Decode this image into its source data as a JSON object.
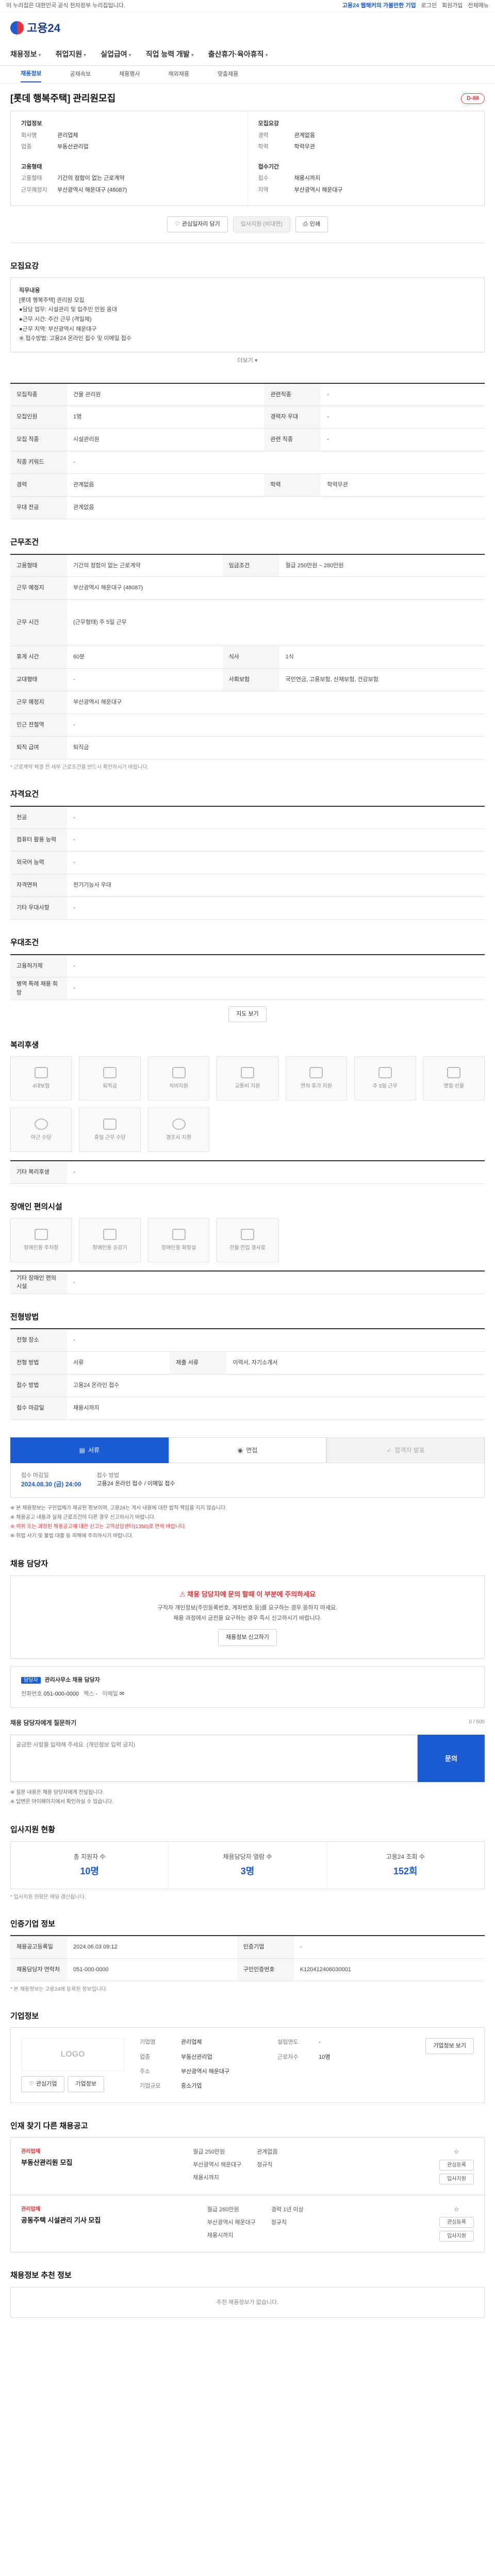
{
  "topbar": {
    "notice": "이 누리집은 대한민국 공식 전자정부 누리집입니다.",
    "right": [
      "고용24 웹해커의 가볼만한 기업",
      "로그인",
      "회원가입",
      "전체메뉴"
    ]
  },
  "brand": {
    "name": "고용24"
  },
  "gnb": [
    "채용정보",
    "취업지원",
    "실업급여",
    "직업 능력 개발",
    "출산휴가·육아휴직"
  ],
  "snb": [
    "채용정보",
    "공채속보",
    "채용행사",
    "해외채용",
    "맞춤채용"
  ],
  "job": {
    "title": "[롯데 행복주택] 관리원모집",
    "dday": "D-88",
    "company_label": "기업정보",
    "company_rows": [
      {
        "k": "회사명",
        "v": "관리업체"
      },
      {
        "k": "업종",
        "v": "부동산관리업"
      }
    ],
    "condition_label": "고용형태",
    "condition_rows": [
      {
        "k": "고용형태",
        "v": "기간의 정함이 없는 근로계약"
      },
      {
        "k": "근무예정지",
        "v": "부산광역시 해운대구 (48087)"
      }
    ],
    "recruit_label": "모집요강",
    "recruit_rows": [
      {
        "k": "경력",
        "v": "관계없음"
      },
      {
        "k": "학력",
        "v": "학력무관"
      }
    ],
    "period_label": "접수기간",
    "period_rows": [
      {
        "k": "접수",
        "v": "채용시까지"
      },
      {
        "k": "지역",
        "v": "부산광역시 해운대구"
      }
    ],
    "buttons": {
      "scrap": "관심일자리 담기",
      "apply": "입사지원 (비대면)",
      "print": "인쇄"
    }
  },
  "sections": {
    "recruit_detail": "모집요강",
    "recruit_detail_text": [
      "직무내용",
      "[롯데 행복주택] 관리원 모집",
      "●담당 업무: 시설관리 및 입주민 민원 응대",
      "●근무 시간: 주간 근무 (격일제)",
      "●근무 지역: 부산광역시 해운대구",
      "※ 접수방법: 고용24 온라인 접수 및 이메일 접수"
    ],
    "recruit_more": "더보기",
    "condition_title": "근무조건",
    "qualification_title": "자격요건",
    "preference_title": "우대조건",
    "welfare_title": "복리후생",
    "disability_title": "장애인 편의시설",
    "selection_title": "전형방법",
    "contact_title": "채용 담당자",
    "stats_title": "입사지원 현황",
    "info_title": "인증기업 정보",
    "company_title": "기업정보",
    "other_jobs_title": "인재 찾기 다른 채용공고",
    "recommend_title": "채용정보 추천 정보"
  },
  "recruit_table": [
    {
      "k": "모집직종",
      "v": "건물 관리원",
      "k2": "관련직종",
      "v2": "-"
    },
    {
      "k": "모집인원",
      "v": "1명",
      "k2": "경력자 우대",
      "v2": "-"
    },
    {
      "k": "모집 직종",
      "v": "시설관리원",
      "k2": "관련 직종",
      "v2": "-"
    },
    {
      "k": "직종 키워드",
      "v": "-",
      "k2": "",
      "v2": ""
    },
    {
      "k": "경력",
      "v": "관계없음",
      "k2": "학력",
      "v2": "학력무관"
    },
    {
      "k": "우대 전공",
      "v": "관계없음",
      "k2": "",
      "v2": ""
    }
  ],
  "condition_table": [
    {
      "k": "고용형태",
      "v": "기간의 정함이 없는 근로계약",
      "k2": "임금조건",
      "v2": "월급 250만원 ~ 280만원"
    },
    {
      "k": "근무 예정지",
      "v": "부산광역시 해운대구 (48087)",
      "k2": "",
      "v2": ""
    },
    {
      "k": "근무 시간",
      "v": "(근무형태) 주 5일 근무",
      "k2": "",
      "v2": ""
    },
    {
      "k": "휴게 시간",
      "v": "60분",
      "k2": "식사",
      "v2": "1식"
    },
    {
      "k": "교대형태",
      "v": "-",
      "k2": "사회보험",
      "v2": "국민연금, 고용보험, 산재보험, 건강보험"
    },
    {
      "k": "근무 예정지",
      "v": "부산광역시 해운대구",
      "k2": "",
      "v2": ""
    },
    {
      "k": "인근 전철역",
      "v": "-",
      "k2": "",
      "v2": ""
    },
    {
      "k": "퇴직 급여",
      "v": "퇴직금",
      "k2": "",
      "v2": ""
    }
  ],
  "condition_note": "* 근로계약 체결 전 세부 근로조건을 반드시 확인하시기 바랍니다.",
  "qualification_table": [
    {
      "k": "전공",
      "v": "-"
    },
    {
      "k": "컴퓨터 활용 능력",
      "v": "-"
    },
    {
      "k": "외국어 능력",
      "v": "-"
    },
    {
      "k": "자격면허",
      "v": "전기기능사 우대"
    },
    {
      "k": "기타 우대사항",
      "v": "-"
    }
  ],
  "preference_table": [
    {
      "k": "고용허가제",
      "v": "-"
    },
    {
      "k": "병역 특례 채용 희망",
      "v": "-"
    }
  ],
  "welfare": {
    "items": [
      "4대보험",
      "퇴직금",
      "식비지원",
      "교통비 지원",
      "연차 휴가 지원",
      "주 5일 근무",
      "명절 선물",
      "야근 수당",
      "휴일 근무 수당",
      "경조사 지원"
    ],
    "other_label": "기타 복리후생",
    "other_value": "-"
  },
  "disability": {
    "items": [
      "장애인용 주차장",
      "장애인용 승강기",
      "장애인용 화장실",
      "건물 진입 경사로"
    ],
    "other_label": "기타 장애인 편의시설",
    "other_value": "-"
  },
  "selection": {
    "table": [
      {
        "k": "전형 장소",
        "v": "-"
      },
      {
        "k": "전형 방법",
        "v": "서류",
        "k2": "제출 서류",
        "v2": "이력서, 자기소개서"
      },
      {
        "k": "접수 방법",
        "v": "고용24 온라인 접수",
        "k2": "",
        "v2": ""
      },
      {
        "k": "접수 마감일",
        "v": "채용시까지",
        "k2": "",
        "v2": ""
      }
    ],
    "tabs": [
      "서류",
      "면접",
      "합격자 발표"
    ],
    "date": "2024.08.30 (금) 24:00",
    "date_label": "접수 마감일",
    "method_label": "접수 방법",
    "method_value": "고용24 온라인 접수 / 이메일 접수",
    "notes": [
      "※ 본 채용정보는 구인업체가 제공한 정보이며, 고용24는 게시 내용에 대한 법적 책임을 지지 않습니다.",
      "※ 채용공고 내용과 실제 근로조건이 다른 경우 신고하시기 바랍니다.",
      "※ 허위 또는 과장된 채용공고에 대한 신고는 고객상담센터(1350)로 연락 바랍니다.",
      "※ 취업 사기 및 불법 대출 등 피해에 주의하시기 바랍니다."
    ]
  },
  "contact": {
    "warn_title": "채용 담당자에 문의 할때 이 부분에 주의하세요",
    "warn_lines": [
      "구직자 개인정보(주민등록번호, 계좌번호 등)를 요구하는 경우 응하지 마세요.",
      "채용 과정에서 금전을 요구하는 경우 즉시 신고하시기 바랍니다."
    ],
    "warn_button": "채용정보 신고하기",
    "badge": "담당자",
    "person": "관리사무소 채용 담당자",
    "phone_label": "전화번호",
    "phone": "051-000-0000",
    "fax_label": "팩스",
    "fax": "-",
    "email_label": "이메일",
    "ask_label": "채용 담당자에게 질문하기",
    "ask_placeholder": "궁금한 사항을 입력해 주세요. (개인정보 입력 금지)",
    "ask_button": "문의",
    "ask_count": "0 / 500",
    "notes": [
      "※ 질문 내용은 채용 담당자에게 전달됩니다.",
      "※ 답변은 마이페이지에서 확인하실 수 있습니다."
    ]
  },
  "stats": {
    "items": [
      {
        "label": "총 지원자 수",
        "value": "10명"
      },
      {
        "label": "채용담당자 열람 수",
        "value": "3명"
      },
      {
        "label": "고용24 조회 수",
        "value": "152회"
      }
    ],
    "note": "* 입사지원 현황은 매일 갱신됩니다."
  },
  "certified": {
    "table": [
      {
        "k": "채용공고등록일",
        "v": "2024.06.03 09:12",
        "k2": "인증기업",
        "v2": "-"
      },
      {
        "k": "채용담당자 연락처",
        "v": "051-000-0000",
        "k2": "구인인증번호",
        "v2": "K120412406030001"
      }
    ],
    "note": "* 본 채용정보는 고용24에 등록된 정보입니다."
  },
  "company": {
    "logo": "LOGO",
    "buttons": [
      "관심기업",
      "기업정보"
    ],
    "rows": [
      {
        "k": "기업명",
        "v": "관리업체",
        "k2": "설립연도",
        "v2": "-"
      },
      {
        "k": "업종",
        "v": "부동산관리업",
        "k2": "근로자수",
        "v2": "10명"
      },
      {
        "k": "주소",
        "v": "부산광역시 해운대구",
        "k2": "",
        "v2": ""
      },
      {
        "k": "기업규모",
        "v": "중소기업",
        "k2": "",
        "v2": ""
      }
    ],
    "detail_button": "기업정보 보기"
  },
  "other_jobs": [
    {
      "co": "관리업체",
      "title": "부동산관리원 모집",
      "pay": "월급 250만원",
      "career": "관계없음",
      "region": "부산광역시 해운대구",
      "type": "정규직",
      "date": "채용시까지",
      "btns": [
        "관심등록",
        "입사지원"
      ]
    },
    {
      "co": "관리업체",
      "title": "공동주택 시설관리 기사 모집",
      "pay": "월급 260만원",
      "career": "경력 1년 이상",
      "region": "부산광역시 해운대구",
      "type": "정규직",
      "date": "채용시까지",
      "btns": [
        "관심등록",
        "입사지원"
      ]
    }
  ],
  "recommend": {
    "empty": "추천 채용정보가 없습니다."
  }
}
